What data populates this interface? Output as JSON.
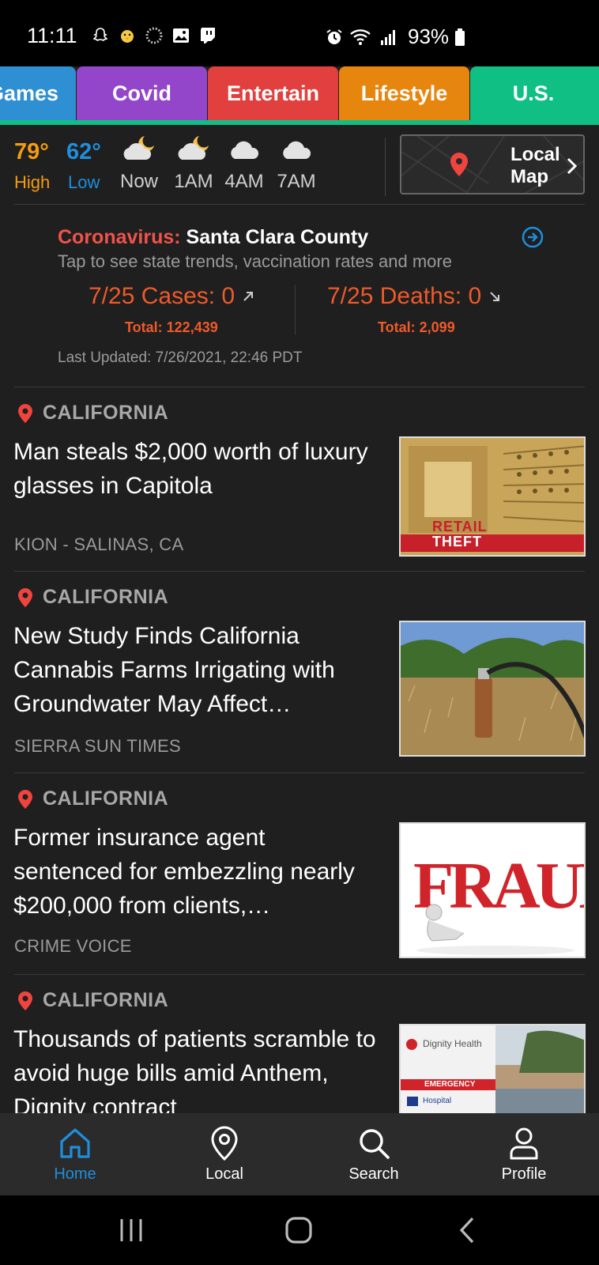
{
  "status_bar": {
    "time": "11:11",
    "battery": "93%",
    "left_icons": [
      "snapchat-icon",
      "chick-icon",
      "sync-icon",
      "gallery-icon",
      "twitch-icon"
    ],
    "right_icons": [
      "alarm-icon",
      "wifi-icon",
      "signal-icon",
      "battery-icon"
    ]
  },
  "tabs": [
    {
      "label": "Games",
      "color": "#2f8fd3"
    },
    {
      "label": "Covid",
      "color": "#9346c9"
    },
    {
      "label": "Entertain",
      "color": "#e2403f"
    },
    {
      "label": "Lifestyle",
      "color": "#e7860e"
    },
    {
      "label": "U.S.",
      "color": "#0fbf84"
    }
  ],
  "weather": {
    "high": "79°",
    "high_label": "High",
    "low": "62°",
    "low_label": "Low",
    "forecast": [
      {
        "time": "Now",
        "icon": "partly-cloudy-night-icon"
      },
      {
        "time": "1AM",
        "icon": "partly-cloudy-night-icon"
      },
      {
        "time": "4AM",
        "icon": "cloud-icon"
      },
      {
        "time": "7AM",
        "icon": "cloud-icon"
      }
    ],
    "local_map_line1": "Local",
    "local_map_line2": "Map",
    "high_color": "#f39c12",
    "low_color": "#1e8fde"
  },
  "covid": {
    "prefix": "Coronavirus:",
    "county": "Santa Clara County",
    "subtitle": "Tap to see state trends, vaccination rates and more",
    "cases": "7/25 Cases: 0",
    "cases_total": "Total: 122,439",
    "deaths": "7/25 Deaths: 0",
    "deaths_total": "Total: 2,099",
    "updated": "Last Updated: 7/26/2021, 22:46 PDT"
  },
  "news": [
    {
      "category": "CALIFORNIA",
      "title": "Man steals $2,000 worth of luxury glasses in Capitola",
      "source": "KION - SALINAS, CA",
      "thumb": "retail-theft",
      "thumb_text_1": "RETAIL",
      "thumb_text_2": "THEFT"
    },
    {
      "category": "CALIFORNIA",
      "title": "New Study Finds California Cannabis Farms Irrigating with Groundwater May Affect…",
      "source": "SIERRA SUN TIMES",
      "thumb": "well-pump"
    },
    {
      "category": "CALIFORNIA",
      "title": "Former insurance agent sentenced for embezzling nearly $200,000 from clients,…",
      "source": "CRIME VOICE",
      "thumb": "fraud",
      "thumb_text_1": "FRAUD"
    },
    {
      "category": "CALIFORNIA",
      "title": "Thousands of patients scramble to avoid huge bills amid Anthem, Dignity contract",
      "source": "",
      "thumb": "dignity-health",
      "thumb_text_1": "Dignity Health",
      "thumb_text_2": "EMERGENCY",
      "thumb_text_3": "Hospital"
    }
  ],
  "bottom_nav": [
    {
      "label": "Home",
      "icon": "home-icon",
      "active": true
    },
    {
      "label": "Local",
      "icon": "location-pin-icon",
      "active": false
    },
    {
      "label": "Search",
      "icon": "search-icon",
      "active": false
    },
    {
      "label": "Profile",
      "icon": "profile-icon",
      "active": false
    }
  ],
  "accent_color": "#1e8fde"
}
